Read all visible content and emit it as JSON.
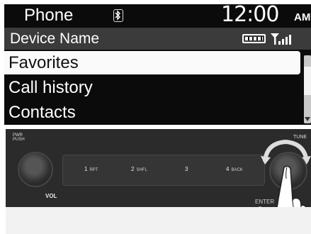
{
  "display": {
    "app_title": "Phone",
    "bluetooth_icon": "bluetooth-icon",
    "clock_time": "12:00",
    "clock_ampm": "AM",
    "device_row_label": "Device Name",
    "battery_icon": "battery-icon",
    "signal_icon": "signal-bars-icon",
    "menu_items": [
      {
        "label": "Favorites",
        "selected": true
      },
      {
        "label": "Call history",
        "selected": false
      },
      {
        "label": "Contacts",
        "selected": false
      }
    ]
  },
  "panel": {
    "pwr_label_line1": "PWR",
    "pwr_label_line2": "PUSH",
    "tune_label": "TUNE",
    "vol_label": "VOL",
    "enter_label": "ENTER",
    "presets": [
      {
        "number": "1",
        "sub": "RPT"
      },
      {
        "number": "2",
        "sub": "SHFL"
      },
      {
        "number": "3",
        "sub": ""
      },
      {
        "number": "4",
        "sub": "BACK"
      }
    ]
  },
  "colors": {
    "display_bg": "#0b0b0b",
    "device_row_bg": "#3b3b3b",
    "selected_bg": "#fafafa",
    "panel_bg": "#2b2b2b"
  }
}
